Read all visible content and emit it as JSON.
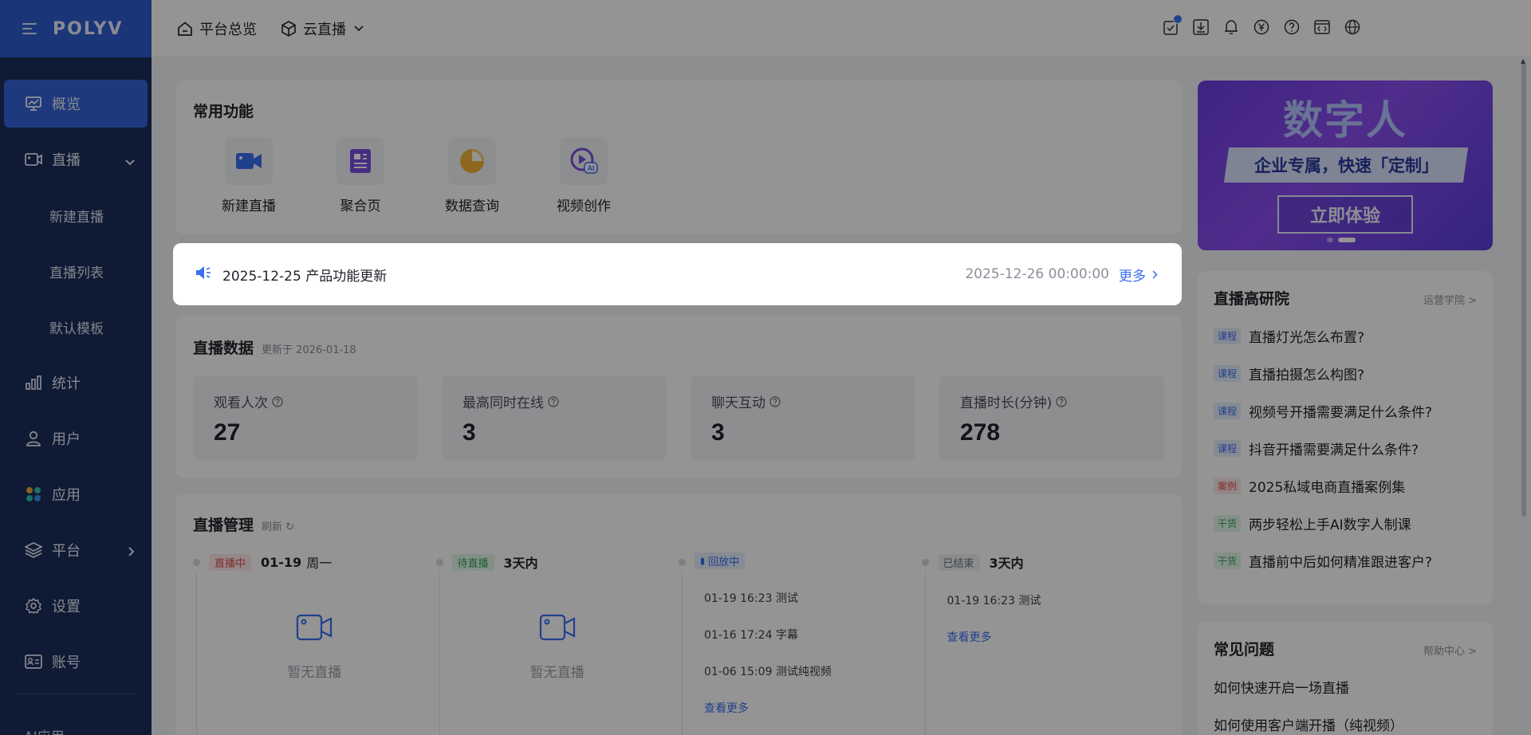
{
  "brand": {
    "logo": "POLYV"
  },
  "sidebar": {
    "items": [
      {
        "label": "概览",
        "icon": "monitor-chart-icon",
        "active": true
      },
      {
        "label": "直播",
        "icon": "camera-icon",
        "expanded": true
      },
      {
        "label": "统计",
        "icon": "bar-chart-icon"
      },
      {
        "label": "用户",
        "icon": "user-icon"
      },
      {
        "label": "应用",
        "icon": "apps-icon"
      },
      {
        "label": "平台",
        "icon": "layers-icon"
      },
      {
        "label": "设置",
        "icon": "gear-icon"
      },
      {
        "label": "账号",
        "icon": "id-card-icon"
      }
    ],
    "sub_items": [
      "新建直播",
      "直播列表",
      "默认模板"
    ],
    "bottom_label": "AI应用"
  },
  "header": {
    "home_label": "平台总览",
    "product_label": "云直播",
    "icons": [
      "task-icon",
      "download-icon",
      "bell-icon",
      "yen-icon",
      "help-icon",
      "code-icon",
      "globe-icon"
    ]
  },
  "common_functions": {
    "title": "常用功能",
    "items": [
      {
        "label": "新建直播",
        "icon": "video-camera-icon",
        "color": "#3a6ff2"
      },
      {
        "label": "聚合页",
        "icon": "document-icon",
        "color": "#7b4fe0"
      },
      {
        "label": "数据查询",
        "icon": "pie-chart-icon",
        "color": "#f5b43a"
      },
      {
        "label": "视频创作",
        "icon": "ai-video-icon",
        "color": "#7b4fe0"
      }
    ]
  },
  "notice": {
    "text": "2025-12-25 产品功能更新",
    "date": "2025-12-26 00:00:00",
    "more": "更多"
  },
  "live_data": {
    "title": "直播数据",
    "updated": "更新于 2026-01-18",
    "stats": [
      {
        "name": "观看人次",
        "value": "27"
      },
      {
        "name": "最高同时在线",
        "value": "3"
      },
      {
        "name": "聊天互动",
        "value": "3"
      },
      {
        "name": "直播时长(分钟)",
        "value": "278"
      }
    ]
  },
  "live_manage": {
    "title": "直播管理",
    "refresh": "刷新",
    "columns": [
      {
        "tag": "直播中",
        "when": "01-19",
        "weekday": "周一",
        "empty": "暂无直播"
      },
      {
        "tag": "待直播",
        "when": "3天内",
        "empty": "暂无直播"
      },
      {
        "tag": "回放中",
        "records": [
          "01-19 16:23 测试",
          "01-16 17:24 字幕",
          "01-06 15:09 测试纯视频"
        ],
        "more": "查看更多"
      },
      {
        "tag": "已结束",
        "when": "3天内",
        "records": [
          "01-19 16:23 测试"
        ],
        "more": "查看更多"
      }
    ]
  },
  "banner": {
    "headline": "数字人",
    "strip": "企业专属，快速「定制」",
    "cta": "立即体验"
  },
  "research": {
    "title": "直播高研院",
    "link": "运营学院 >",
    "courses": [
      {
        "tag": "课程",
        "kind": "k",
        "title": "直播灯光怎么布置?"
      },
      {
        "tag": "课程",
        "kind": "k",
        "title": "直播拍摄怎么构图?"
      },
      {
        "tag": "课程",
        "kind": "k",
        "title": "视频号开播需要满足什么条件?"
      },
      {
        "tag": "课程",
        "kind": "k",
        "title": "抖音开播需要满足什么条件?"
      },
      {
        "tag": "案例",
        "kind": "a",
        "title": "2025私域电商直播案例集"
      },
      {
        "tag": "干货",
        "kind": "g",
        "title": "两步轻松上手AI数字人制课"
      },
      {
        "tag": "干货",
        "kind": "g",
        "title": "直播前中后如何精准跟进客户?"
      }
    ]
  },
  "faq": {
    "title": "常见问题",
    "link": "帮助中心 >",
    "questions": [
      "如何快速开启一场直播",
      "如何使用客户端开播（纯视频）"
    ]
  }
}
